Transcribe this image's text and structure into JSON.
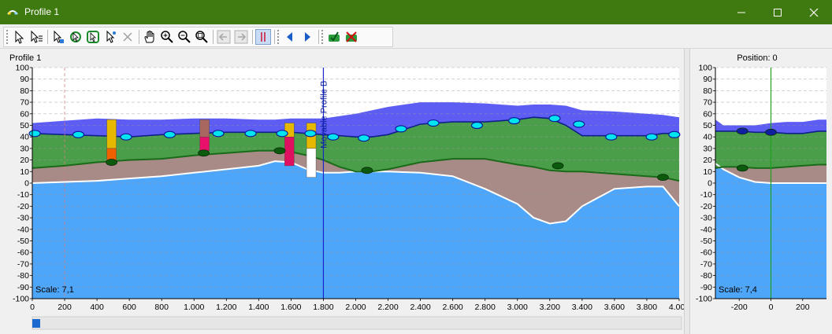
{
  "window": {
    "title": "Profile 1",
    "title_bar_color": "#3f7a10",
    "icon": "profile-app-icon",
    "controls": [
      "minimize-icon",
      "maximize-icon",
      "close-icon"
    ]
  },
  "toolbar": {
    "buttons": [
      {
        "name": "select-tool-button",
        "icon": "arrow-pointer-icon"
      },
      {
        "name": "select-list-button",
        "icon": "arrow-list-icon"
      },
      {
        "name": "select-objects-button",
        "icon": "arrow-select-icon"
      },
      {
        "name": "rotate-select-button",
        "icon": "rotate-arrow-icon"
      },
      {
        "name": "refresh-select-button",
        "icon": "refresh-arrow-icon"
      },
      {
        "name": "star-select-button",
        "icon": "star-arrow-icon"
      },
      {
        "name": "delete-button",
        "icon": "cross-icon",
        "disabled": true
      },
      {
        "name": "pan-button",
        "icon": "hand-icon"
      },
      {
        "name": "zoom-in-button",
        "icon": "zoom-in-icon"
      },
      {
        "name": "zoom-out-button",
        "icon": "zoom-out-icon"
      },
      {
        "name": "zoom-extent-button",
        "icon": "zoom-extent-icon"
      },
      {
        "name": "back-button",
        "icon": "arrow-left-box-icon",
        "disabled": true
      },
      {
        "name": "forward-button",
        "icon": "arrow-right-box-icon",
        "disabled": true
      },
      {
        "name": "columns-toggle-button",
        "icon": "columns-icon",
        "active": true
      },
      {
        "name": "previous-button",
        "icon": "triangle-left-icon"
      },
      {
        "name": "next-button",
        "icon": "triangle-right-icon"
      },
      {
        "name": "accept-button",
        "icon": "green-check-icon"
      },
      {
        "name": "reject-button",
        "icon": "red-x-icon"
      }
    ]
  },
  "main_profile": {
    "title": "Profile 1",
    "scale_text": "Scale: 7,1",
    "movable_profile_label": "Movable Profile B",
    "scrollbar_position": 0,
    "colors": {
      "water": "#1818f0",
      "upper_layer": "#4a9e4a",
      "clay": "#a88a86",
      "base": "#4ea6fa",
      "marker": "#00e6f0",
      "node": "#0c5a0c"
    }
  },
  "side_profile": {
    "title": "Position: 0"
  },
  "chart_data": [
    {
      "type": "area",
      "title": "Profile 1",
      "xlim": [
        0,
        4000
      ],
      "ylim": [
        -100,
        100
      ],
      "x_ticks": [
        "0",
        "200",
        "400",
        "600",
        "800",
        "1.000",
        "1.200",
        "1.400",
        "1.600",
        "1.800",
        "2.000",
        "2.200",
        "2.400",
        "2.600",
        "2.800",
        "3.000",
        "3.200",
        "3.400",
        "3.600",
        "3.800",
        "4.000"
      ],
      "y_ticks": [
        100,
        90,
        80,
        70,
        60,
        50,
        40,
        30,
        20,
        10,
        0,
        -10,
        -20,
        -30,
        -40,
        -50,
        -60,
        -70,
        -80,
        -90,
        -100
      ],
      "grid": true,
      "vertical_lines": [
        {
          "x": 200,
          "style": "dashed",
          "color": "#d08080"
        },
        {
          "x": 1800,
          "style": "solid",
          "color": "#1828c8",
          "label": "Movable Profile B"
        }
      ],
      "x": [
        0,
        200,
        400,
        600,
        800,
        1000,
        1200,
        1400,
        1500,
        1600,
        1700,
        1800,
        1900,
        2000,
        2100,
        2200,
        2400,
        2600,
        2800,
        3000,
        3100,
        3200,
        3300,
        3400,
        3600,
        3800,
        3900,
        4000
      ],
      "series": [
        {
          "name": "top",
          "values": [
            52,
            54,
            56,
            55,
            55,
            56,
            56,
            55,
            55,
            56,
            56,
            56,
            58,
            60,
            63,
            66,
            70,
            70,
            69,
            67,
            68,
            68,
            67,
            63,
            62,
            60,
            59,
            57
          ]
        },
        {
          "name": "layer-1",
          "values": [
            43,
            42,
            41,
            40,
            42,
            43,
            44,
            44,
            44,
            44,
            43,
            42,
            41,
            40,
            40,
            42,
            51,
            53,
            53,
            55,
            57,
            56,
            50,
            41,
            41,
            41,
            43,
            43
          ]
        },
        {
          "name": "layer-2",
          "values": [
            13,
            15,
            18,
            20,
            21,
            24,
            26,
            28,
            28,
            27,
            24,
            20,
            14,
            10,
            10,
            12,
            18,
            21,
            21,
            16,
            14,
            11,
            10,
            10,
            8,
            6,
            5,
            2
          ]
        },
        {
          "name": "layer-3",
          "values": [
            0,
            1,
            2,
            4,
            6,
            9,
            12,
            15,
            19,
            18,
            12,
            9,
            9,
            10,
            10,
            10,
            9,
            6,
            -5,
            -18,
            -30,
            -35,
            -33,
            -20,
            -5,
            -3,
            -3,
            -20
          ]
        }
      ],
      "markers": [
        {
          "x": 15,
          "y": 43
        },
        {
          "x": 285,
          "y": 42
        },
        {
          "x": 580,
          "y": 40
        },
        {
          "x": 850,
          "y": 42
        },
        {
          "x": 1150,
          "y": 43
        },
        {
          "x": 1350,
          "y": 43
        },
        {
          "x": 1545,
          "y": 43
        },
        {
          "x": 1720,
          "y": 43
        },
        {
          "x": 1860,
          "y": 40
        },
        {
          "x": 2050,
          "y": 39
        },
        {
          "x": 2280,
          "y": 47
        },
        {
          "x": 2480,
          "y": 52
        },
        {
          "x": 2750,
          "y": 50
        },
        {
          "x": 2980,
          "y": 54
        },
        {
          "x": 3230,
          "y": 56
        },
        {
          "x": 3380,
          "y": 51
        },
        {
          "x": 3580,
          "y": 40
        },
        {
          "x": 3830,
          "y": 40
        },
        {
          "x": 3970,
          "y": 42
        }
      ],
      "nodes": [
        {
          "x": 490,
          "y": 18
        },
        {
          "x": 1060,
          "y": 26
        },
        {
          "x": 1530,
          "y": 28
        },
        {
          "x": 2070,
          "y": 11
        },
        {
          "x": 3250,
          "y": 15
        },
        {
          "x": 3900,
          "y": 5
        }
      ],
      "boreholes": [
        {
          "x": 490,
          "top": 55,
          "bottom": 18,
          "segments": [
            {
              "from": 55,
              "to": 30,
              "color": "#e6b800"
            },
            {
              "from": 30,
              "to": 18,
              "color": "#f06000"
            }
          ]
        },
        {
          "x": 1065,
          "top": 55,
          "bottom": 28,
          "segments": [
            {
              "from": 55,
              "to": 40,
              "color": "#a86860"
            },
            {
              "from": 40,
              "to": 28,
              "color": "#e8106a"
            }
          ]
        },
        {
          "x": 1590,
          "top": 52,
          "bottom": 15,
          "segments": [
            {
              "from": 52,
              "to": 40,
              "color": "#e6b800"
            },
            {
              "from": 40,
              "to": 15,
              "color": "#e01060"
            }
          ]
        },
        {
          "x": 1725,
          "top": 52,
          "bottom": 5,
          "segments": [
            {
              "from": 52,
              "to": 30,
              "color": "#e6b800"
            },
            {
              "from": 30,
              "to": 5,
              "color": "#ffffff"
            }
          ]
        }
      ]
    },
    {
      "type": "area",
      "title": "Position: 0",
      "xlim": [
        -350,
        350
      ],
      "ylim": [
        -100,
        100
      ],
      "x_ticks": [
        "-200",
        "0",
        "200"
      ],
      "y_ticks": [
        100,
        90,
        80,
        70,
        60,
        50,
        40,
        30,
        20,
        10,
        0,
        -10,
        -20,
        -30,
        -40,
        -50,
        -60,
        -70,
        -80,
        -90,
        -100
      ],
      "grid": true,
      "vertical_lines": [
        {
          "x": 0,
          "style": "solid",
          "color": "#20a020"
        }
      ],
      "scale_text": "Scale: 7,4",
      "x": [
        -350,
        -300,
        -200,
        -100,
        0,
        100,
        200,
        300,
        350
      ],
      "series": [
        {
          "name": "top",
          "values": [
            55,
            50,
            50,
            50,
            52,
            53,
            53,
            55,
            55
          ]
        },
        {
          "name": "layer-1",
          "values": [
            45,
            45,
            45,
            44,
            44,
            43,
            43,
            45,
            45
          ]
        },
        {
          "name": "layer-2",
          "values": [
            13,
            14,
            14,
            13,
            13,
            14,
            15,
            16,
            16
          ]
        },
        {
          "name": "layer-3",
          "values": [
            17,
            12,
            5,
            1,
            0,
            0,
            0,
            0,
            0
          ]
        }
      ],
      "nodes": [
        {
          "x": -180,
          "y": 45
        },
        {
          "x": 0,
          "y": 44
        },
        {
          "x": -180,
          "y": 13
        }
      ]
    }
  ]
}
